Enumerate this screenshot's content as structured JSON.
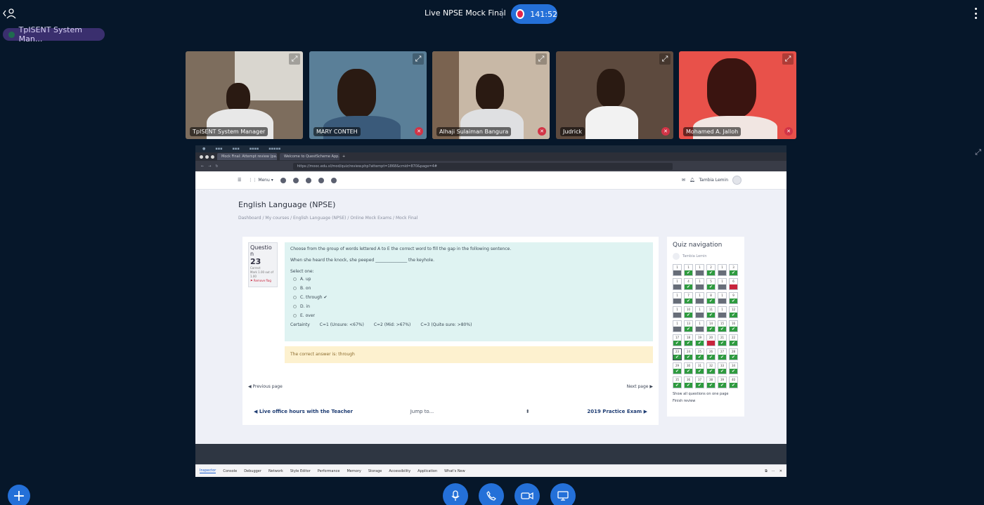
{
  "top": {
    "meeting_title": "Live NPSE Mock Final",
    "timer": "141:52",
    "presenter_chip": "TpISENT System Man..."
  },
  "participants": [
    {
      "name": "TpISENT System Manager",
      "muted": false,
      "bg": "#8a7a68"
    },
    {
      "name": "MARY CONTEH",
      "muted": true,
      "bg": "#4d6f88"
    },
    {
      "name": "Alhaji Sulaiman Bangura",
      "muted": true,
      "bg": "#c9b9a8"
    },
    {
      "name": "Judrick",
      "muted": true,
      "bg": "#6e5a4c"
    },
    {
      "name": "Mohamed A. Jalloh",
      "muted": true,
      "bg": "#e8514a"
    }
  ],
  "browser": {
    "tabs": [
      "Mock Final: Attempt review (pa...",
      "Welcome to QuestScheme App..."
    ],
    "url": "https://mooc.edu.sl/mod/quiz/review.php?attempt=1868&cmid=870&page=4#"
  },
  "moodle": {
    "menu_label": "Menu",
    "user_name": "Tambia Lemin",
    "course_title": "English Language (NPSE)",
    "breadcrumb": "Dashboard  /  My courses  /  English Language (NPSE)  /  Online Mock Exams  /  Mock Final",
    "question": {
      "label": "Questio n",
      "number": "23",
      "status": "Correct",
      "marks": "Mark 1.00 out of 1.00",
      "flag": "Remove flag",
      "prompt": "Choose from the group of words lettered A to E the correct word to fill the gap in the following sentence.",
      "sentence": "When she heard the knock, she peeped _______________ the keyhole.",
      "select_one": "Select one:",
      "options": [
        "A. up",
        "B. on",
        "C. through ✔",
        "D. in",
        "E. over"
      ],
      "certainty_label": "Certainty",
      "certainty_options": [
        "C=1 (Unsure: <67%)",
        "C=2 (Mid: >67%)",
        "C=3 (Quite sure: >80%)"
      ],
      "feedback": "The correct answer is: through"
    },
    "pager": {
      "prev": "◀ Previous page",
      "next": "Next page ▶"
    },
    "activity_nav": {
      "prev": "◀ Live office hours with the Teacher",
      "jump": "Jump to...",
      "next": "2019 Practice Exam ▶"
    },
    "quiz_nav": {
      "title": "Quiz navigation",
      "user": "Tambia Lemin",
      "show_all": "Show all questions on one page",
      "finish": "Finish review",
      "cells": [
        {
          "n": "1",
          "s": "none"
        },
        {
          "n": "1",
          "s": "correct"
        },
        {
          "n": "1",
          "s": "none"
        },
        {
          "n": "2",
          "s": "correct"
        },
        {
          "n": "1",
          "s": "none"
        },
        {
          "n": "3",
          "s": "correct"
        },
        {
          "n": "1",
          "s": "none"
        },
        {
          "n": "4",
          "s": "correct"
        },
        {
          "n": "1",
          "s": "none"
        },
        {
          "n": "5",
          "s": "correct"
        },
        {
          "n": "1",
          "s": "none"
        },
        {
          "n": "6",
          "s": "wrong"
        },
        {
          "n": "1",
          "s": "none"
        },
        {
          "n": "7",
          "s": "correct"
        },
        {
          "n": "1",
          "s": "none"
        },
        {
          "n": "8",
          "s": "correct"
        },
        {
          "n": "1",
          "s": "none"
        },
        {
          "n": "9",
          "s": "correct"
        },
        {
          "n": "1",
          "s": "none"
        },
        {
          "n": "10",
          "s": "correct"
        },
        {
          "n": "1",
          "s": "none"
        },
        {
          "n": "11",
          "s": "correct"
        },
        {
          "n": "1",
          "s": "none"
        },
        {
          "n": "12",
          "s": "correct"
        },
        {
          "n": "1",
          "s": "none"
        },
        {
          "n": "13",
          "s": "correct"
        },
        {
          "n": "1",
          "s": "none"
        },
        {
          "n": "14",
          "s": "correct"
        },
        {
          "n": "15",
          "s": "correct"
        },
        {
          "n": "16",
          "s": "correct"
        },
        {
          "n": "17",
          "s": "correct"
        },
        {
          "n": "18",
          "s": "correct"
        },
        {
          "n": "19",
          "s": "correct"
        },
        {
          "n": "20",
          "s": "wrong"
        },
        {
          "n": "21",
          "s": "correct"
        },
        {
          "n": "22",
          "s": "correct"
        },
        {
          "n": "23",
          "s": "correct"
        },
        {
          "n": "24",
          "s": "correct"
        },
        {
          "n": "25",
          "s": "correct"
        },
        {
          "n": "26",
          "s": "correct"
        },
        {
          "n": "27",
          "s": "correct"
        },
        {
          "n": "28",
          "s": "correct"
        },
        {
          "n": "29",
          "s": "correct"
        },
        {
          "n": "30",
          "s": "correct"
        },
        {
          "n": "31",
          "s": "correct"
        },
        {
          "n": "32",
          "s": "correct"
        },
        {
          "n": "33",
          "s": "correct"
        },
        {
          "n": "34",
          "s": "correct"
        },
        {
          "n": "35",
          "s": "correct"
        },
        {
          "n": "36",
          "s": "correct"
        },
        {
          "n": "37",
          "s": "correct"
        },
        {
          "n": "38",
          "s": "correct"
        },
        {
          "n": "39",
          "s": "correct"
        },
        {
          "n": "40",
          "s": "correct"
        }
      ]
    }
  },
  "devtools": [
    "Inspector",
    "Console",
    "Debugger",
    "Network",
    "Style Editor",
    "Performance",
    "Memory",
    "Storage",
    "Accessibility",
    "Application",
    "What's New"
  ],
  "colors": {
    "accent": "#2470d8",
    "background": "#06172a",
    "correct": "#2e9a3f",
    "wrong": "#c8243c"
  }
}
